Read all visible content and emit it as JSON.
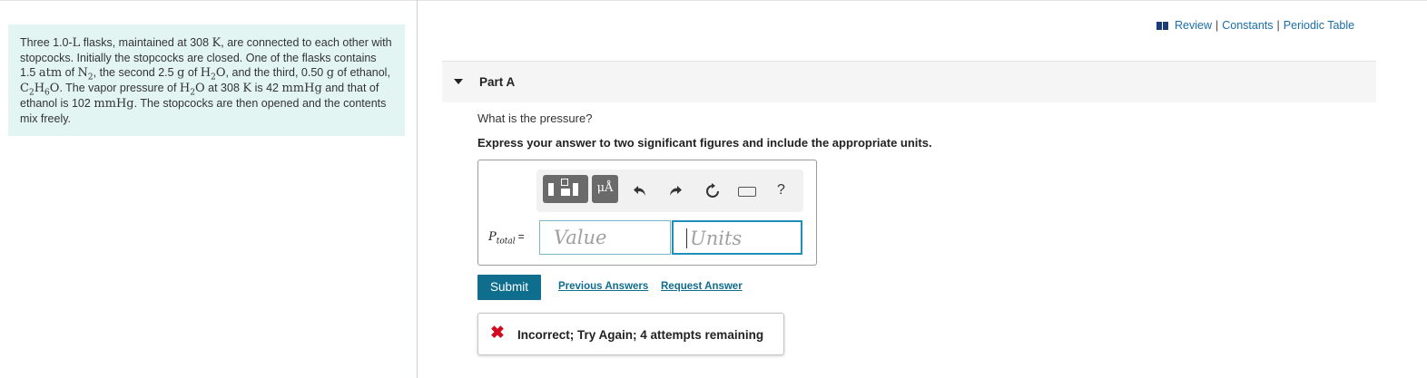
{
  "problem": {
    "s1": "Three 1.0-",
    "L": "L",
    "s2": " flasks, maintained at 308 ",
    "K": "K",
    "s3": ", are connected to each other with stopcocks. Initially the stopcocks are closed. One of the flasks contains 1.5 ",
    "atm": "atm",
    "s4": " of ",
    "N": "N",
    "N_sub": "2",
    "s5": ", the second 2.5 ",
    "g1": "g",
    "s6": " of ",
    "H": "H",
    "H_sub": "2",
    "O": "O",
    "s7": ", and the third, 0.50 ",
    "g2": "g",
    "s8": " of ethanol, ",
    "C": "C",
    "C_sub": "2",
    "H2": "H",
    "H2_sub": "6",
    "O2": "O",
    "s9": ". The vapor pressure of ",
    "H3": "H",
    "H3_sub": "2",
    "O3": "O",
    "s10": " at 308 ",
    "K2": "K",
    "s11": " is 42 ",
    "mmHg1": "mmHg",
    "s12": " and that of ethanol is 102 ",
    "mmHg2": "mmHg",
    "s13": ". The stopcocks are then opened and the contents mix freely."
  },
  "top_links": {
    "review": "Review",
    "constants": "Constants",
    "periodic": "Periodic Table",
    "sep": "|"
  },
  "part": {
    "title": "Part A"
  },
  "question": "What is the pressure?",
  "instructions": "Express your answer to two significant figures and include the appropriate units.",
  "toolbar": {
    "units_symbol": "μÅ",
    "help": "?"
  },
  "answer": {
    "label_var": "P",
    "label_sub": "total",
    "label_eq": "=",
    "value_placeholder": "Value",
    "units_placeholder": "Units"
  },
  "actions": {
    "submit": "Submit",
    "previous_answers": "Previous Answers",
    "request_answer": "Request Answer"
  },
  "feedback": {
    "icon": "✖",
    "text": "Incorrect; Try Again; 4 attempts remaining"
  },
  "colors": {
    "problem_bg": "#e2f5f3",
    "link": "#1a6ea8",
    "submit_bg": "#0f6d8e",
    "error": "#d10a1f"
  }
}
